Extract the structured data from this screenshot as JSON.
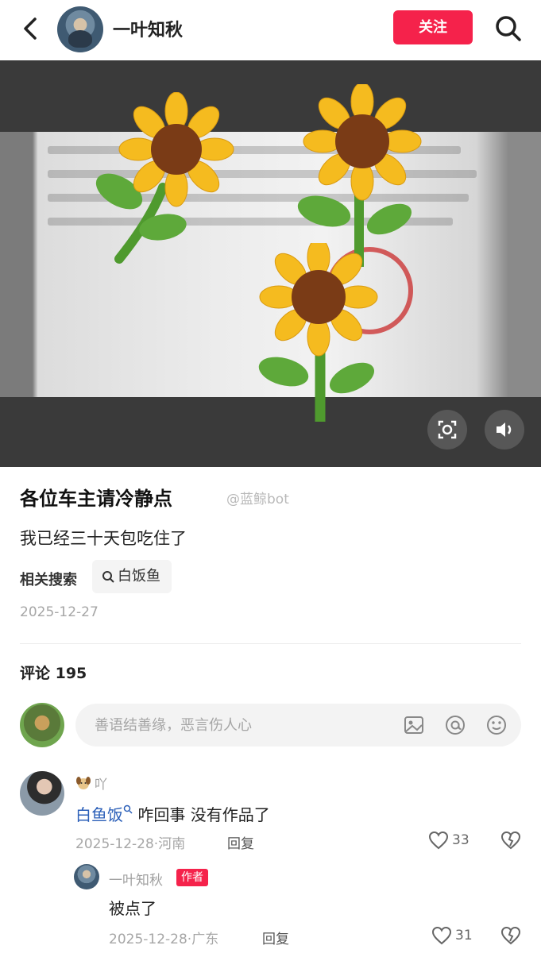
{
  "header": {
    "username": "一叶知秋",
    "follow_label": "关注"
  },
  "post": {
    "title": "各位车主请冷静点",
    "watermark": "@蓝鲸bot",
    "body": "我已经三十天包吃住了",
    "related_label": "相关搜索",
    "related_query": "白饭鱼",
    "date": "2025-12-27"
  },
  "comments": {
    "count_label": "评论 195",
    "input_placeholder": "善语结善缘，恶言伤人心",
    "items": [
      {
        "user": "吖",
        "mention": "白鱼饭",
        "text": " 咋回事 没有作品了",
        "meta": "2025-12-28·河南",
        "reply_label": "回复",
        "likes": "33",
        "reply": {
          "user": "一叶知秋",
          "badge": "作者",
          "text": "被点了",
          "meta": "2025-12-28·广东",
          "reply_label": "回复",
          "likes": "31"
        }
      }
    ]
  }
}
